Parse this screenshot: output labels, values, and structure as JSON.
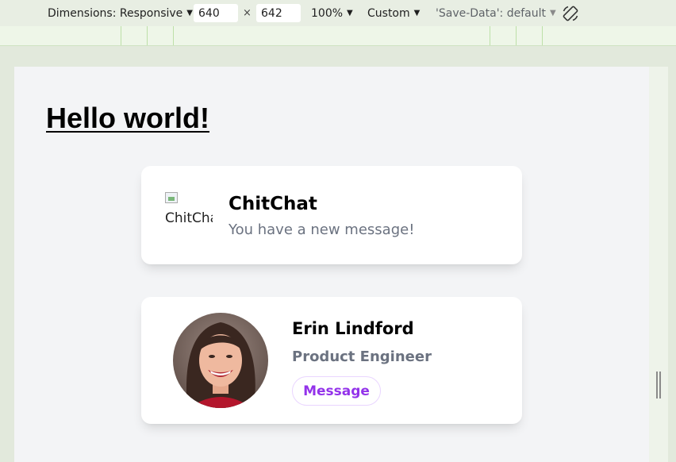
{
  "toolbar": {
    "dimensions_label": "Dimensions: Responsive",
    "width_value": "640",
    "times_symbol": "×",
    "height_value": "642",
    "zoom_label": "100%",
    "throttle_label": "Custom",
    "save_data_label": "'Save-Data': default",
    "caret": "▼"
  },
  "page": {
    "heading": "Hello world!"
  },
  "notification_card": {
    "image_alt": "ChitChat",
    "title": "ChitChat",
    "message": "You have a new message!"
  },
  "profile_card": {
    "name": "Erin Lindford",
    "role": "Product Engineer",
    "button_label": "Message"
  },
  "colors": {
    "accent": "#9333ea",
    "muted_text": "#6b7280",
    "viewport_bg": "#f3f4f6"
  }
}
